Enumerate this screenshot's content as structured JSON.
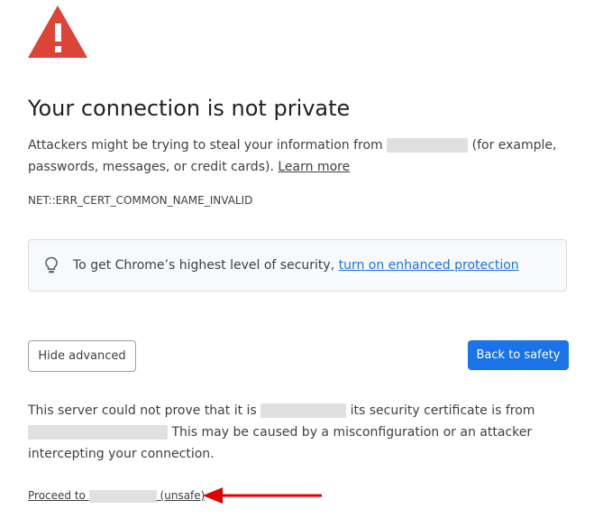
{
  "page": {
    "title": "Your connection is not private",
    "message_part1": "Attackers might be trying to steal your information from",
    "message_part2": "(for example, passwords, messages, or credit cards).",
    "learn_more": "Learn more",
    "error_code": "NET::ERR_CERT_COMMON_NAME_INVALID"
  },
  "enhanced": {
    "text": "To get Chrome’s highest level of security,",
    "link": "turn on enhanced protection",
    "icon": "lightbulb-icon"
  },
  "buttons": {
    "hide_advanced": "Hide advanced",
    "back_to_safety": "Back to safety"
  },
  "details": {
    "part1": "This server could not prove that it is",
    "part2": "its security certificate is from",
    "part3": "This may be caused by a misconfiguration or an attacker intercepting your connection."
  },
  "proceed": {
    "prefix": "Proceed to",
    "suffix": "(unsafe)"
  },
  "colors": {
    "warning_red": "#db4437",
    "accent_blue": "#1a73e8",
    "annotation_arrow": "#e00000"
  },
  "icons": {
    "warning": "warning-triangle-icon",
    "arrow": "red-arrow-left-icon"
  }
}
